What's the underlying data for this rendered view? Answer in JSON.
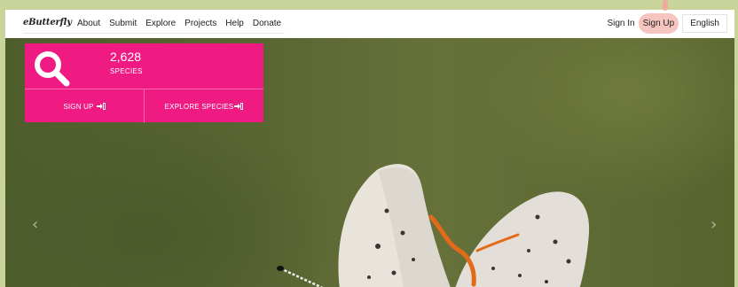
{
  "nav": {
    "logo": "eButterfly",
    "items": [
      "About",
      "Submit",
      "Explore",
      "Projects",
      "Help",
      "Donate"
    ],
    "sign_in": "Sign In",
    "sign_up": "Sign Up",
    "language": "English"
  },
  "promo": {
    "count": "2,628",
    "count_label": "SPECIES",
    "signup_label": "SIGN UP",
    "explore_label": "EXPLORE SPECIES"
  },
  "carousel": {
    "prev_icon": "‹",
    "next_icon": "›"
  },
  "colors": {
    "accent": "#f01a83",
    "frame": "#c8d49a",
    "cursor_highlight": "#f7c5c0"
  }
}
